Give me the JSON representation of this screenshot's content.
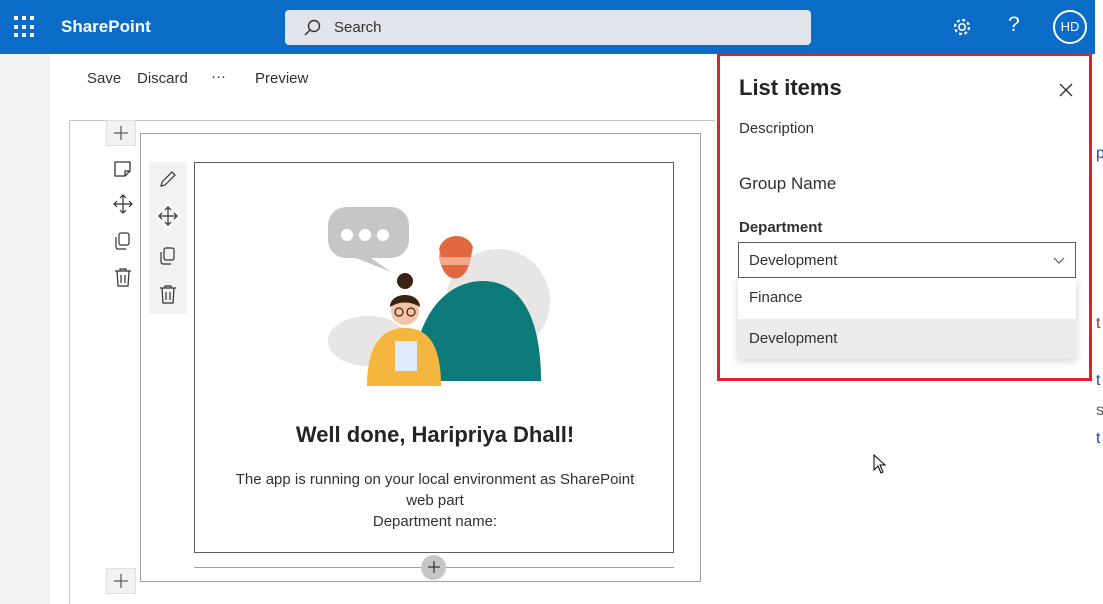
{
  "topbar": {
    "brand": "SharePoint",
    "search_placeholder": "Search",
    "avatar_initials": "HD",
    "help_glyph": "?"
  },
  "commands": {
    "save": "Save",
    "discard": "Discard",
    "more": "···",
    "preview": "Preview"
  },
  "webpart": {
    "title": "Well done, Haripriya Dhall!",
    "description_line1": "The app is running on your local environment as SharePoint",
    "description_line2": "web part",
    "description_line3": "Department name:"
  },
  "panel": {
    "title": "List items",
    "description": "Description",
    "group_name": "Group Name",
    "department_label": "Department",
    "department_value": "Development",
    "options": [
      "Finance",
      "Development"
    ],
    "selected_option": "Development"
  },
  "colors": {
    "suite_bar": "#0a6cc7",
    "highlight_border": "#d9242f",
    "selected_option_bg": "#edebe9"
  },
  "icons": [
    "waffle-icon",
    "search-icon",
    "gear-icon",
    "help-icon",
    "close-icon",
    "chevron-down-icon",
    "edit-icon",
    "move-icon",
    "duplicate-icon",
    "delete-icon",
    "add-icon"
  ]
}
